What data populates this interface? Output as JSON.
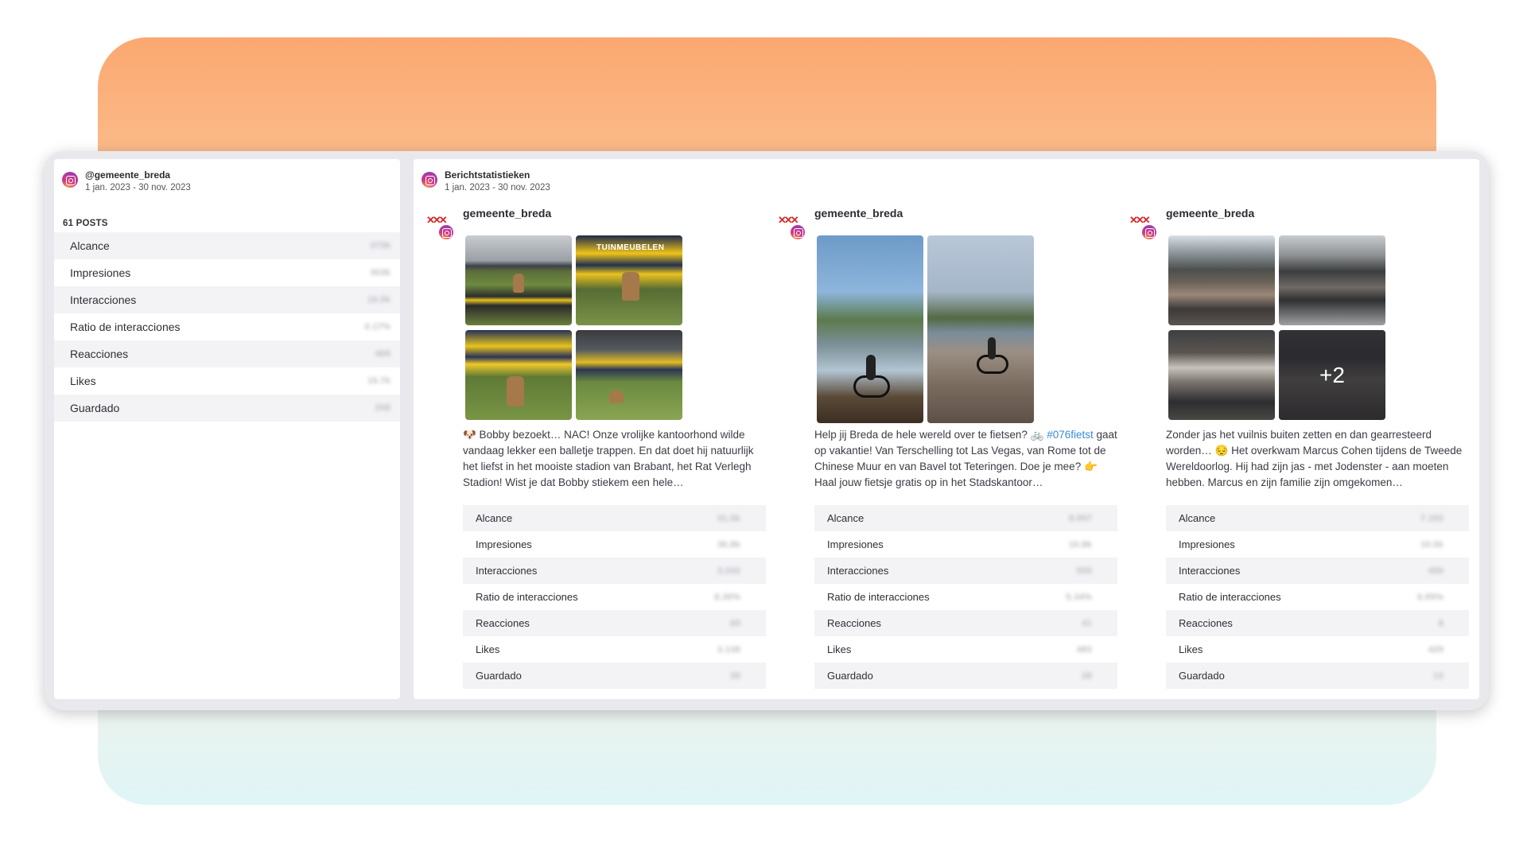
{
  "profile": {
    "handle": "@gemeente_breda",
    "date_range": "1 jan. 2023 - 30 nov. 2023",
    "posts_count": "61 POSTS",
    "stats": [
      {
        "label": "Alcance",
        "value": "373k"
      },
      {
        "label": "Impresiones",
        "value": "303k"
      },
      {
        "label": "Interacciones",
        "value": "16.0k"
      },
      {
        "label": "Ratio de interacciones",
        "value": "4.17%"
      },
      {
        "label": "Reacciones",
        "value": "468"
      },
      {
        "label": "Likes",
        "value": "15.7k"
      },
      {
        "label": "Guardado",
        "value": "258"
      }
    ]
  },
  "main": {
    "title": "Berichtstatistieken",
    "date_range": "1 jan. 2023 - 30 nov. 2023"
  },
  "posts": [
    {
      "username": "gemeente_breda",
      "caption": "🐶 Bobby bezoekt… NAC! Onze vrolijke kantoorhond wilde vandaag lekker een balletje trappen. En dat doet hij natuurlijk het liefst in het mooiste stadion van Brabant, het Rat Verlegh Stadion! Wist je dat Bobby stiekem een hele…",
      "caption_hashtag": "",
      "caption_rest": "",
      "photo_text": "TUINMEUBELEN",
      "more_count": "",
      "stats": [
        {
          "label": "Alcance",
          "value": "31.0k"
        },
        {
          "label": "Impresiones",
          "value": "36.8k"
        },
        {
          "label": "Interacciones",
          "value": "3.242"
        },
        {
          "label": "Ratio de interacciones",
          "value": "8.30%"
        },
        {
          "label": "Reacciones",
          "value": "69"
        },
        {
          "label": "Likes",
          "value": "3.138"
        },
        {
          "label": "Guardado",
          "value": "35"
        }
      ]
    },
    {
      "username": "gemeente_breda",
      "caption": "Help jij Breda de hele wereld over te fietsen? 🚲 ",
      "caption_hashtag": "#076fietst",
      "caption_rest": " gaat op vakantie! Van Terschelling tot Las Vegas, van Rome tot de Chinese Muur en van Bavel tot Teteringen. Doe je mee? 👉 Haal jouw fietsje gratis op in het Stadskantoor…",
      "photo_text": "",
      "more_count": "",
      "stats": [
        {
          "label": "Alcance",
          "value": "8.057"
        },
        {
          "label": "Impresiones",
          "value": "10.8k"
        },
        {
          "label": "Interacciones",
          "value": "555"
        },
        {
          "label": "Ratio de interacciones",
          "value": "5.34%"
        },
        {
          "label": "Reacciones",
          "value": "41"
        },
        {
          "label": "Likes",
          "value": "483"
        },
        {
          "label": "Guardado",
          "value": "28"
        }
      ]
    },
    {
      "username": "gemeente_breda",
      "caption": "Zonder jas het vuilnis buiten zetten en dan gearresteerd worden… 😔 Het overkwam Marcus Cohen tijdens de Tweede Wereldoorlog. Hij had zijn jas - met Jodenster - aan moeten hebben. Marcus en zijn familie zijn omgekomen…",
      "caption_hashtag": "",
      "caption_rest": "",
      "photo_text": "",
      "more_count": "+2",
      "stats": [
        {
          "label": "Alcance",
          "value": "7.102"
        },
        {
          "label": "Impresiones",
          "value": "10.0k"
        },
        {
          "label": "Interacciones",
          "value": "450"
        },
        {
          "label": "Ratio de interacciones",
          "value": "6.05%"
        },
        {
          "label": "Reacciones",
          "value": "8"
        },
        {
          "label": "Likes",
          "value": "429"
        },
        {
          "label": "Guardado",
          "value": "13"
        }
      ]
    }
  ]
}
